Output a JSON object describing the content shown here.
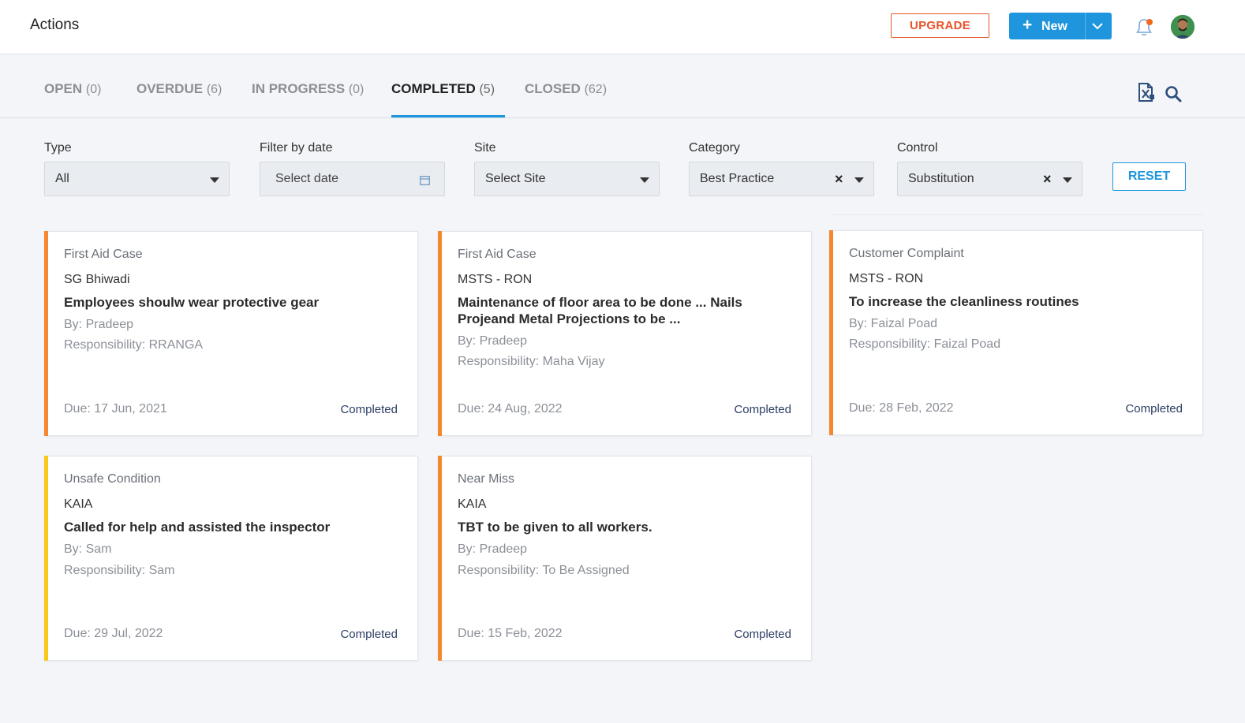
{
  "header": {
    "title": "Actions",
    "upgrade_label": "UPGRADE",
    "new_label": "New"
  },
  "tabs": [
    {
      "label": "OPEN",
      "count": "(0)"
    },
    {
      "label": "OVERDUE",
      "count": "(6)"
    },
    {
      "label": "IN PROGRESS",
      "count": "(0)"
    },
    {
      "label": "COMPLETED",
      "count": "(5)"
    },
    {
      "label": "CLOSED",
      "count": "(62)"
    }
  ],
  "active_tab": "COMPLETED",
  "filters": {
    "type": {
      "label": "Type",
      "value": "All"
    },
    "date": {
      "label": "Filter by date",
      "placeholder": "Select date"
    },
    "site": {
      "label": "Site",
      "placeholder": "Select Site"
    },
    "category": {
      "label": "Category",
      "value": "Best Practice"
    },
    "control": {
      "label": "Control",
      "value": "Substitution"
    },
    "reset_label": "RESET"
  },
  "colors": {
    "accent": "#1e95dc",
    "upgrade": "#e8542c",
    "priority_orange": "#f5882e",
    "priority_yellow": "#f8c81c"
  },
  "cards": [
    {
      "type": "First Aid Case",
      "site": "SG Bhiwadi",
      "title": "Employees shoulw wear protective gear",
      "by": "By: Pradeep",
      "responsibility": "Responsibility: RRANGA",
      "due": "Due: 17 Jun, 2021",
      "status": "Completed",
      "priority_color": "#f5882e"
    },
    {
      "type": "First Aid Case",
      "site": "MSTS - RON",
      "title": "Maintenance of floor area to be done ... Nails Projeand Metal Projections to be ...",
      "by": "By: Pradeep",
      "responsibility": "Responsibility: Maha Vijay",
      "due": "Due: 24 Aug, 2022",
      "status": "Completed",
      "priority_color": "#f5882e"
    },
    {
      "type": "Customer Complaint",
      "site": "MSTS - RON",
      "title": "To increase the cleanliness routines",
      "by": "By: Faizal Poad",
      "responsibility": "Responsibility: Faizal Poad",
      "due": "Due: 28 Feb, 2022",
      "status": "Completed",
      "priority_color": "#f5882e"
    },
    {
      "type": "Unsafe Condition",
      "site": "KAIA",
      "title": "Called for help and assisted the inspector",
      "by": "By: Sam",
      "responsibility": "Responsibility: Sam",
      "due": "Due: 29 Jul, 2022",
      "status": "Completed",
      "priority_color": "#f8c81c"
    },
    {
      "type": "Near Miss",
      "site": "KAIA",
      "title": "TBT to be given to all workers.",
      "by": "By: Pradeep",
      "responsibility": "Responsibility: To Be Assigned",
      "due": "Due: 15 Feb, 2022",
      "status": "Completed",
      "priority_color": "#f5882e"
    }
  ]
}
